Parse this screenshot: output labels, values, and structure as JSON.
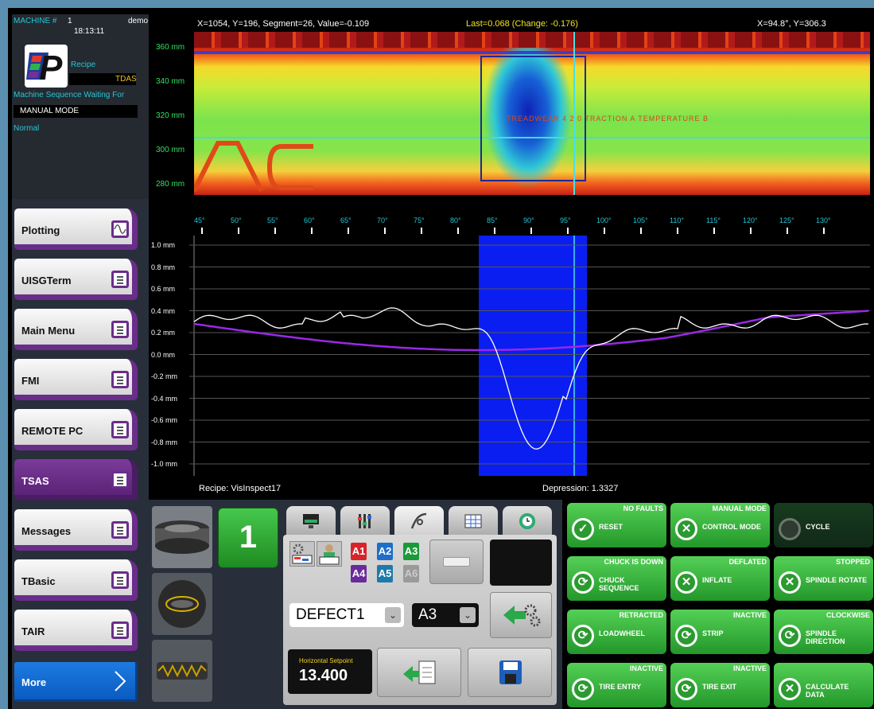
{
  "status_panel": {
    "machine_label": "MACHINE #",
    "machine_number": "1",
    "user": "demo",
    "time": "18:13:11",
    "recipe_label": "Recipe",
    "recipe_value": "TDAS",
    "sequence_label": "Machine Sequence Waiting For",
    "mode_value": "MANUAL MODE",
    "state_value": "Normal",
    "logo_letter": "P"
  },
  "nav": {
    "items": [
      {
        "label": "Plotting",
        "icon": "wave-icon"
      },
      {
        "label": "UISGTerm",
        "icon": "document-icon"
      },
      {
        "label": "Main Menu",
        "icon": "document-icon"
      },
      {
        "label": "FMI",
        "icon": "document-icon"
      },
      {
        "label": "REMOTE PC",
        "icon": "document-icon"
      },
      {
        "label": "TSAS",
        "icon": "document-icon"
      },
      {
        "label": "Messages",
        "icon": "document-icon"
      },
      {
        "label": "TBasic",
        "icon": "document-icon"
      },
      {
        "label": "TAIR",
        "icon": "document-icon"
      }
    ],
    "more_label": "More",
    "active": "TSAS"
  },
  "top_plot": {
    "cursor_readout": "X=1054, Y=196, Segment=26, Value=-0.109",
    "last_readout": "Last=0.068  (Change: -0.176)",
    "angle_readout": "X=94.8°, Y=306.3",
    "y_labels": [
      "360 mm",
      "340 mm",
      "320 mm",
      "300 mm",
      "280 mm"
    ],
    "x_labels": [
      "45°",
      "50°",
      "55°",
      "60°",
      "65°",
      "70°",
      "75°",
      "80°",
      "85°",
      "90°",
      "95°",
      "100°",
      "105°",
      "110°",
      "115°",
      "120°",
      "125°",
      "130°"
    ],
    "sidewall_text": "TREADWEAR 4 2 0   TRACTION  A  TEMPERATURE  B"
  },
  "profile_plot": {
    "y_labels": [
      "1.0 mm",
      "0.8 mm",
      "0.6 mm",
      "0.4 mm",
      "0.2 mm",
      "0.0 mm",
      "-0.2 mm",
      "-0.4 mm",
      "-0.6 mm",
      "-0.8 mm",
      "-1.0 mm"
    ],
    "recipe_text": "Recipe: VisInspect17",
    "depression_text": "Depression: 1.3327"
  },
  "controls": {
    "station_number": "1",
    "analysis_buttons": [
      "A1",
      "A2",
      "A3",
      "A4",
      "A5",
      "A6"
    ],
    "defect_select": "DEFECT1",
    "analysis_select": "A3",
    "setpoint_label": "Horizontal Setpoint",
    "setpoint_value": "13.400"
  },
  "operations": [
    {
      "status": "NO FAULTS",
      "label": "RESET",
      "icon": "check-icon",
      "enabled": true
    },
    {
      "status": "MANUAL MODE",
      "label": "CONTROL MODE",
      "icon": "x-icon",
      "enabled": true
    },
    {
      "status": "",
      "label": "CYCLE",
      "icon": "circle-icon",
      "enabled": false
    },
    {
      "status": "CHUCK IS DOWN",
      "label": "CHUCK SEQUENCE",
      "icon": "refresh-icon",
      "enabled": true
    },
    {
      "status": "DEFLATED",
      "label": "INFLATE",
      "icon": "x-icon",
      "enabled": true
    },
    {
      "status": "STOPPED",
      "label": "SPINDLE ROTATE",
      "icon": "x-icon",
      "enabled": true
    },
    {
      "status": "RETRACTED",
      "label": "LOADWHEEL",
      "icon": "refresh-icon",
      "enabled": true
    },
    {
      "status": "INACTIVE",
      "label": "STRIP",
      "icon": "refresh-icon",
      "enabled": true
    },
    {
      "status": "CLOCKWISE",
      "label": "SPINDLE DIRECTION",
      "icon": "refresh-icon",
      "enabled": true
    },
    {
      "status": "INACTIVE",
      "label": "TIRE ENTRY",
      "icon": "refresh-icon",
      "enabled": true
    },
    {
      "status": "INACTIVE",
      "label": "TIRE EXIT",
      "icon": "refresh-icon",
      "enabled": true
    },
    {
      "status": "",
      "label": "CALCULATE DATA",
      "icon": "x-icon",
      "enabled": true
    }
  ]
}
